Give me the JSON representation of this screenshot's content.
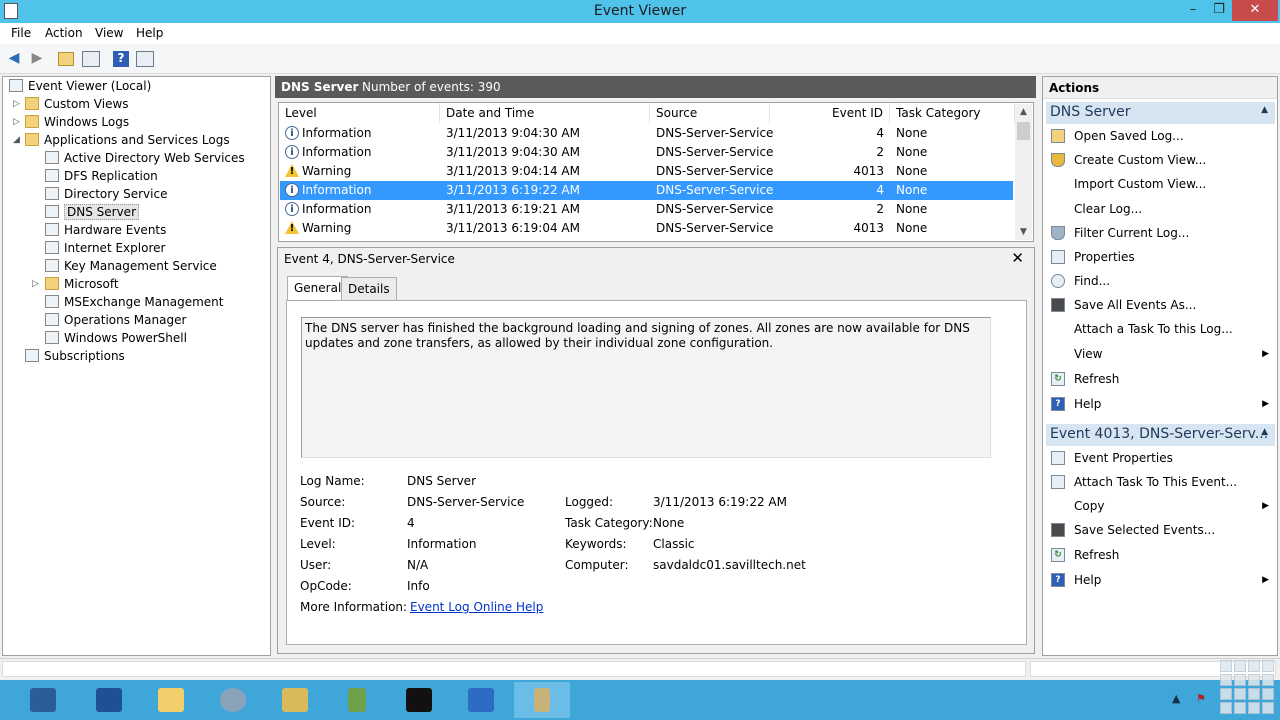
{
  "window": {
    "title": "Event Viewer",
    "minimize": "–",
    "maximize": "❐",
    "close": "✕"
  },
  "menu": [
    "File",
    "Action",
    "View",
    "Help"
  ],
  "toolbar": {
    "back": "◀",
    "forward": "▶",
    "help": "?"
  },
  "tree": {
    "root": "Event Viewer (Local)",
    "custom_views": "Custom Views",
    "windows_logs": "Windows Logs",
    "app_services": "Applications and Services Logs",
    "children": [
      "Active Directory Web Services",
      "DFS Replication",
      "Directory Service",
      "DNS Server",
      "Hardware Events",
      "Internet Explorer",
      "Key Management Service",
      "Microsoft",
      "MSExchange Management",
      "Operations Manager",
      "Windows PowerShell"
    ],
    "subscriptions": "Subscriptions",
    "selected": "DNS Server"
  },
  "center": {
    "log_name": "DNS Server",
    "event_count": "Number of events: 390"
  },
  "columns": {
    "level": "Level",
    "date": "Date and Time",
    "source": "Source",
    "event_id": "Event ID",
    "task": "Task Category"
  },
  "events": [
    {
      "level": "Information",
      "icon": "info-icon",
      "date": "3/11/2013 9:04:30 AM",
      "source": "DNS-Server-Service",
      "event_id": "4",
      "task": "None"
    },
    {
      "level": "Information",
      "icon": "info-icon",
      "date": "3/11/2013 9:04:30 AM",
      "source": "DNS-Server-Service",
      "event_id": "2",
      "task": "None"
    },
    {
      "level": "Warning",
      "icon": "warning-icon",
      "date": "3/11/2013 9:04:14 AM",
      "source": "DNS-Server-Service",
      "event_id": "4013",
      "task": "None"
    },
    {
      "level": "Information",
      "icon": "info-icon",
      "date": "3/11/2013 6:19:22 AM",
      "source": "DNS-Server-Service",
      "event_id": "4",
      "task": "None"
    },
    {
      "level": "Information",
      "icon": "info-icon",
      "date": "3/11/2013 6:19:21 AM",
      "source": "DNS-Server-Service",
      "event_id": "2",
      "task": "None"
    },
    {
      "level": "Warning",
      "icon": "warning-icon",
      "date": "3/11/2013 6:19:04 AM",
      "source": "DNS-Server-Service",
      "event_id": "4013",
      "task": "None"
    }
  ],
  "detail": {
    "title": "Event 4, DNS-Server-Service",
    "close": "✕",
    "tabs": {
      "general": "General",
      "details": "Details"
    },
    "description": "The DNS server has finished the background loading and signing of zones. All zones are now available for DNS updates and zone transfers, as allowed by their individual zone configuration.",
    "labels": {
      "log_name": "Log Name:",
      "source": "Source:",
      "event_id": "Event ID:",
      "level": "Level:",
      "user": "User:",
      "opcode": "OpCode:",
      "more_info": "More Information:",
      "logged": "Logged:",
      "task_category": "Task Category:",
      "keywords": "Keywords:",
      "computer": "Computer:"
    },
    "values": {
      "log_name": "DNS Server",
      "source": "DNS-Server-Service",
      "event_id": "4",
      "level": "Information",
      "user": "N/A",
      "opcode": "Info",
      "more_info": "Event Log Online Help",
      "logged": "3/11/2013 6:19:22 AM",
      "task_category": "None",
      "keywords": "Classic",
      "computer": "savdaldc01.savilltech.net"
    }
  },
  "actions": {
    "header": "Actions",
    "section1": {
      "title": "DNS Server",
      "items": [
        "Open Saved Log...",
        "Create Custom View...",
        "Import Custom View...",
        "Clear Log...",
        "Filter Current Log...",
        "Properties",
        "Find...",
        "Save All Events As...",
        "Attach a Task To this Log...",
        "View",
        "Refresh",
        "Help"
      ]
    },
    "section2": {
      "title": "Event 4013, DNS-Server-Serv...",
      "items": [
        "Event Properties",
        "Attach Task To This Event...",
        "Copy",
        "Save Selected Events...",
        "Refresh",
        "Help"
      ]
    }
  },
  "colors": {
    "titlebar": "#4fc3ea",
    "taskbar": "#3fa6d9",
    "selection": "#3399ff",
    "section_header": "#d7e4f2"
  }
}
